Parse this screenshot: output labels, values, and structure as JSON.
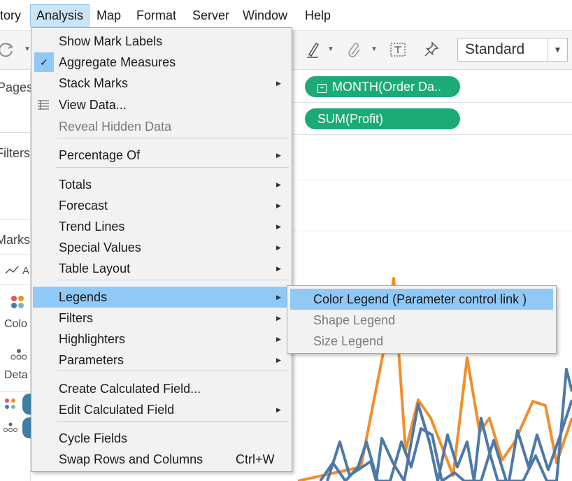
{
  "menubar": {
    "items": [
      "tory",
      "Analysis",
      "Map",
      "Format",
      "Server",
      "Window",
      "Help"
    ],
    "active_index": 1
  },
  "toolbar": {
    "icons": [
      "refresh-icon",
      "highlighter-icon",
      "paperclip-icon",
      "text-box-icon",
      "pin-icon"
    ],
    "fit_select_value": "Standard"
  },
  "left_panel": {
    "pages_label": "Pages",
    "filters_label": "Filters",
    "marks_label": "Marks",
    "marks_type_fragment": "A",
    "color_label": "Colo",
    "detail_label": "Deta"
  },
  "shelves": {
    "columns_pill": "MONTH(Order Da..",
    "rows_pill": "SUM(Profit)"
  },
  "analysis_menu": {
    "items": [
      {
        "label": "Show Mark Labels"
      },
      {
        "label": "Aggregate Measures",
        "checked": true
      },
      {
        "label": "Stack Marks",
        "submenu": true
      },
      {
        "label": "View Data...",
        "icon": "view-data-icon"
      },
      {
        "label": "Reveal Hidden Data",
        "disabled": true
      },
      {
        "label": "Percentage Of",
        "submenu": true
      },
      {
        "label": "Totals",
        "submenu": true
      },
      {
        "label": "Forecast",
        "submenu": true
      },
      {
        "label": "Trend Lines",
        "submenu": true
      },
      {
        "label": "Special Values",
        "submenu": true
      },
      {
        "label": "Table Layout",
        "submenu": true
      },
      {
        "label": "Legends",
        "submenu": true,
        "highlighted": true
      },
      {
        "label": "Filters",
        "submenu": true
      },
      {
        "label": "Highlighters",
        "submenu": true
      },
      {
        "label": "Parameters",
        "submenu": true
      },
      {
        "label": "Create Calculated Field..."
      },
      {
        "label": "Edit Calculated Field",
        "submenu": true
      },
      {
        "label": "Cycle Fields"
      },
      {
        "label": "Swap Rows and Columns",
        "shortcut": "Ctrl+W"
      }
    ]
  },
  "legends_submenu": {
    "items": [
      {
        "label": "Color Legend (Parameter control link )",
        "highlighted": true
      },
      {
        "label": "Shape Legend",
        "disabled": true
      },
      {
        "label": "Size Legend",
        "disabled": true
      }
    ]
  },
  "chart_data": {
    "type": "line",
    "series": [
      {
        "color": "#f28e2b",
        "points": [
          [
            8,
            688
          ],
          [
            98,
            668
          ],
          [
            130,
            505
          ],
          [
            145,
            398
          ],
          [
            162,
            645
          ],
          [
            180,
            572
          ],
          [
            198,
            598
          ],
          [
            230,
            680
          ],
          [
            250,
            512
          ],
          [
            268,
            618
          ],
          [
            282,
            598
          ],
          [
            300,
            658
          ],
          [
            318,
            632
          ],
          [
            344,
            574
          ],
          [
            362,
            580
          ],
          [
            378,
            662
          ],
          [
            400,
            598
          ]
        ]
      },
      {
        "color": "#4e79a7",
        "points": [
          [
            50,
            688
          ],
          [
            68,
            632
          ],
          [
            82,
            680
          ],
          [
            100,
            668
          ],
          [
            112,
            660
          ],
          [
            120,
            688
          ],
          [
            128,
            627
          ],
          [
            144,
            662
          ],
          [
            160,
            688
          ],
          [
            180,
            578
          ],
          [
            196,
            632
          ],
          [
            208,
            688
          ],
          [
            222,
            622
          ],
          [
            236,
            668
          ],
          [
            250,
            632
          ],
          [
            260,
            688
          ],
          [
            270,
            598
          ],
          [
            282,
            647
          ],
          [
            294,
            688
          ],
          [
            310,
            688
          ],
          [
            322,
            616
          ],
          [
            338,
            668
          ],
          [
            350,
            622
          ],
          [
            366,
            672
          ],
          [
            384,
            620
          ],
          [
            400,
            572
          ]
        ]
      },
      {
        "color": "#4e79a7",
        "points": [
          [
            40,
            688
          ],
          [
            58,
            662
          ],
          [
            76,
            688
          ],
          [
            94,
            668
          ],
          [
            106,
            632
          ],
          [
            122,
            688
          ],
          [
            140,
            688
          ],
          [
            156,
            632
          ],
          [
            170,
            668
          ],
          [
            184,
            613
          ],
          [
            200,
            622
          ],
          [
            214,
            688
          ],
          [
            232,
            676
          ],
          [
            246,
            688
          ],
          [
            270,
            688
          ],
          [
            288,
            630
          ],
          [
            306,
            688
          ],
          [
            330,
            688
          ],
          [
            348,
            652
          ],
          [
            364,
            688
          ],
          [
            378,
            688
          ],
          [
            392,
            528
          ],
          [
            400,
            560
          ]
        ]
      }
    ]
  }
}
